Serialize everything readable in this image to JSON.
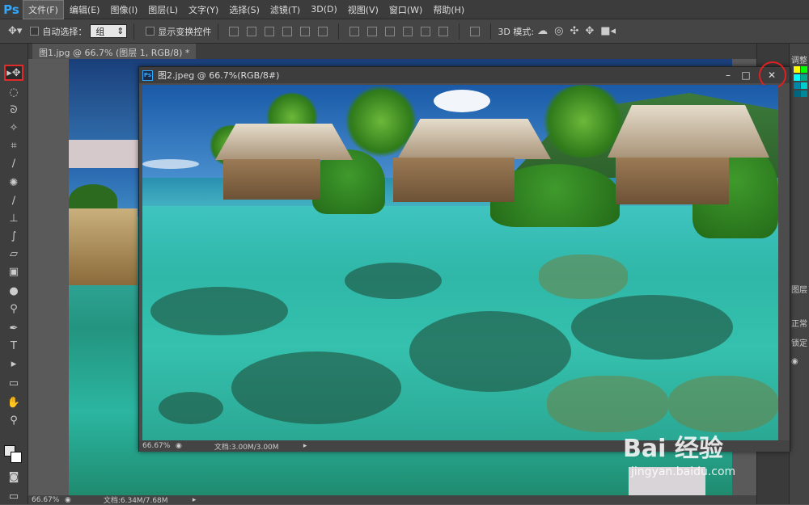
{
  "app": {
    "logo": "Ps"
  },
  "menu": [
    "文件(F)",
    "编辑(E)",
    "图像(I)",
    "图层(L)",
    "文字(Y)",
    "选择(S)",
    "滤镜(T)",
    "3D(D)",
    "视图(V)",
    "窗口(W)",
    "帮助(H)"
  ],
  "options": {
    "auto_select_label": "自动选择：",
    "auto_select_value": "组",
    "show_transform_label": "显示变换控件",
    "mode_3d_label": "3D 模式:"
  },
  "background_doc": {
    "tab_title": "图1.jpg @ 66.7% (图层 1, RGB/8) *",
    "zoom": "66.67%",
    "doc_info": "文档:6.34M/7.68M"
  },
  "floating_doc": {
    "title": "图2.jpeg @ 66.7%(RGB/8#)",
    "zoom": "66.67%",
    "doc_info": "文档:3.00M/3.00M"
  },
  "right_panel": {
    "adjust_label": "调整",
    "layers_label": "图层",
    "normal_label": "正常",
    "lock_label": "锁定"
  },
  "watermark": {
    "logo": "Bai 经验",
    "url": "jingyan.baidu.com"
  },
  "colors": {
    "accent_red": "#e02020",
    "ps_blue": "#31a8ff"
  }
}
